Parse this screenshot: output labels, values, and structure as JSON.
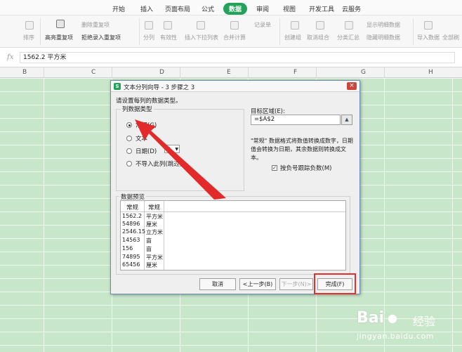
{
  "ribbon": {
    "tabs": [
      {
        "label": "开始"
      },
      {
        "label": "插入"
      },
      {
        "label": "页面布局"
      },
      {
        "label": "公式"
      },
      {
        "label": "数据",
        "active": true
      },
      {
        "label": "审阅"
      },
      {
        "label": "视图"
      },
      {
        "label": "开发工具"
      },
      {
        "label": "云服务"
      }
    ],
    "accent_color": "#23a35a"
  },
  "toolbar": {
    "sort": "排序",
    "highlight_dup": "高亮重复项",
    "delete_dup": "删除重复项",
    "reject_dup": "拒绝录入重复项",
    "split": "分列",
    "validity": "有效性",
    "insert_dropdown": "插入下拉列表",
    "merge_calc": "合并计算",
    "record_list": "记录单",
    "create_group": "创建组",
    "ungroup": "取消组合",
    "subtotal": "分类汇总",
    "show_detail": "显示明细数据",
    "hide_detail": "隐藏明细数据",
    "import_data": "导入数据",
    "refresh_all": "全部刷"
  },
  "formula_bar": {
    "fx": "fx",
    "value": "1562.2 平方米"
  },
  "columns": [
    "B",
    "C",
    "D",
    "E",
    "F",
    "G",
    "H"
  ],
  "dialog": {
    "title": "文本分列向导 - 3 步骤之 3",
    "title_icon": "S",
    "close": "×",
    "prompt": "请设置每列的数据类型。",
    "column_type_legend": "列数据类型",
    "options": [
      {
        "label": "常规(G)",
        "checked": true
      },
      {
        "label": "文本",
        "checked": false
      },
      {
        "label": "日期(D)",
        "checked": false
      },
      {
        "label": "不导入此列(跳过)",
        "checked": false
      }
    ],
    "date_format_value": "Y",
    "target_label": "目标区域(E):",
    "target_value": "=$A$2",
    "description": "\"常规\" 数据格式将数值转换成数字，日期值会转换为日期，其余数据则转换成文本。",
    "negative_checkbox_label": "按负号跟踪负数(M)",
    "negative_checked": true,
    "preview_legend": "数据预览",
    "preview_headers": [
      "常规",
      "常规"
    ],
    "preview_rows": [
      [
        "1562.2",
        "平方米"
      ],
      [
        "54896",
        "厘米"
      ],
      [
        "2546.15",
        "立方米"
      ],
      [
        "14563",
        "亩"
      ],
      [
        "156",
        "亩"
      ],
      [
        "74895",
        "平方米"
      ],
      [
        "65456",
        "厘米"
      ]
    ],
    "buttons": {
      "cancel": "取消",
      "back": "<上一步(B)",
      "next": "下一步(N)>",
      "finish": "完成(F)"
    }
  },
  "watermark": {
    "brand": "Bai",
    "brand_suffix": "经验",
    "url": "jingyan.baidu.com"
  }
}
